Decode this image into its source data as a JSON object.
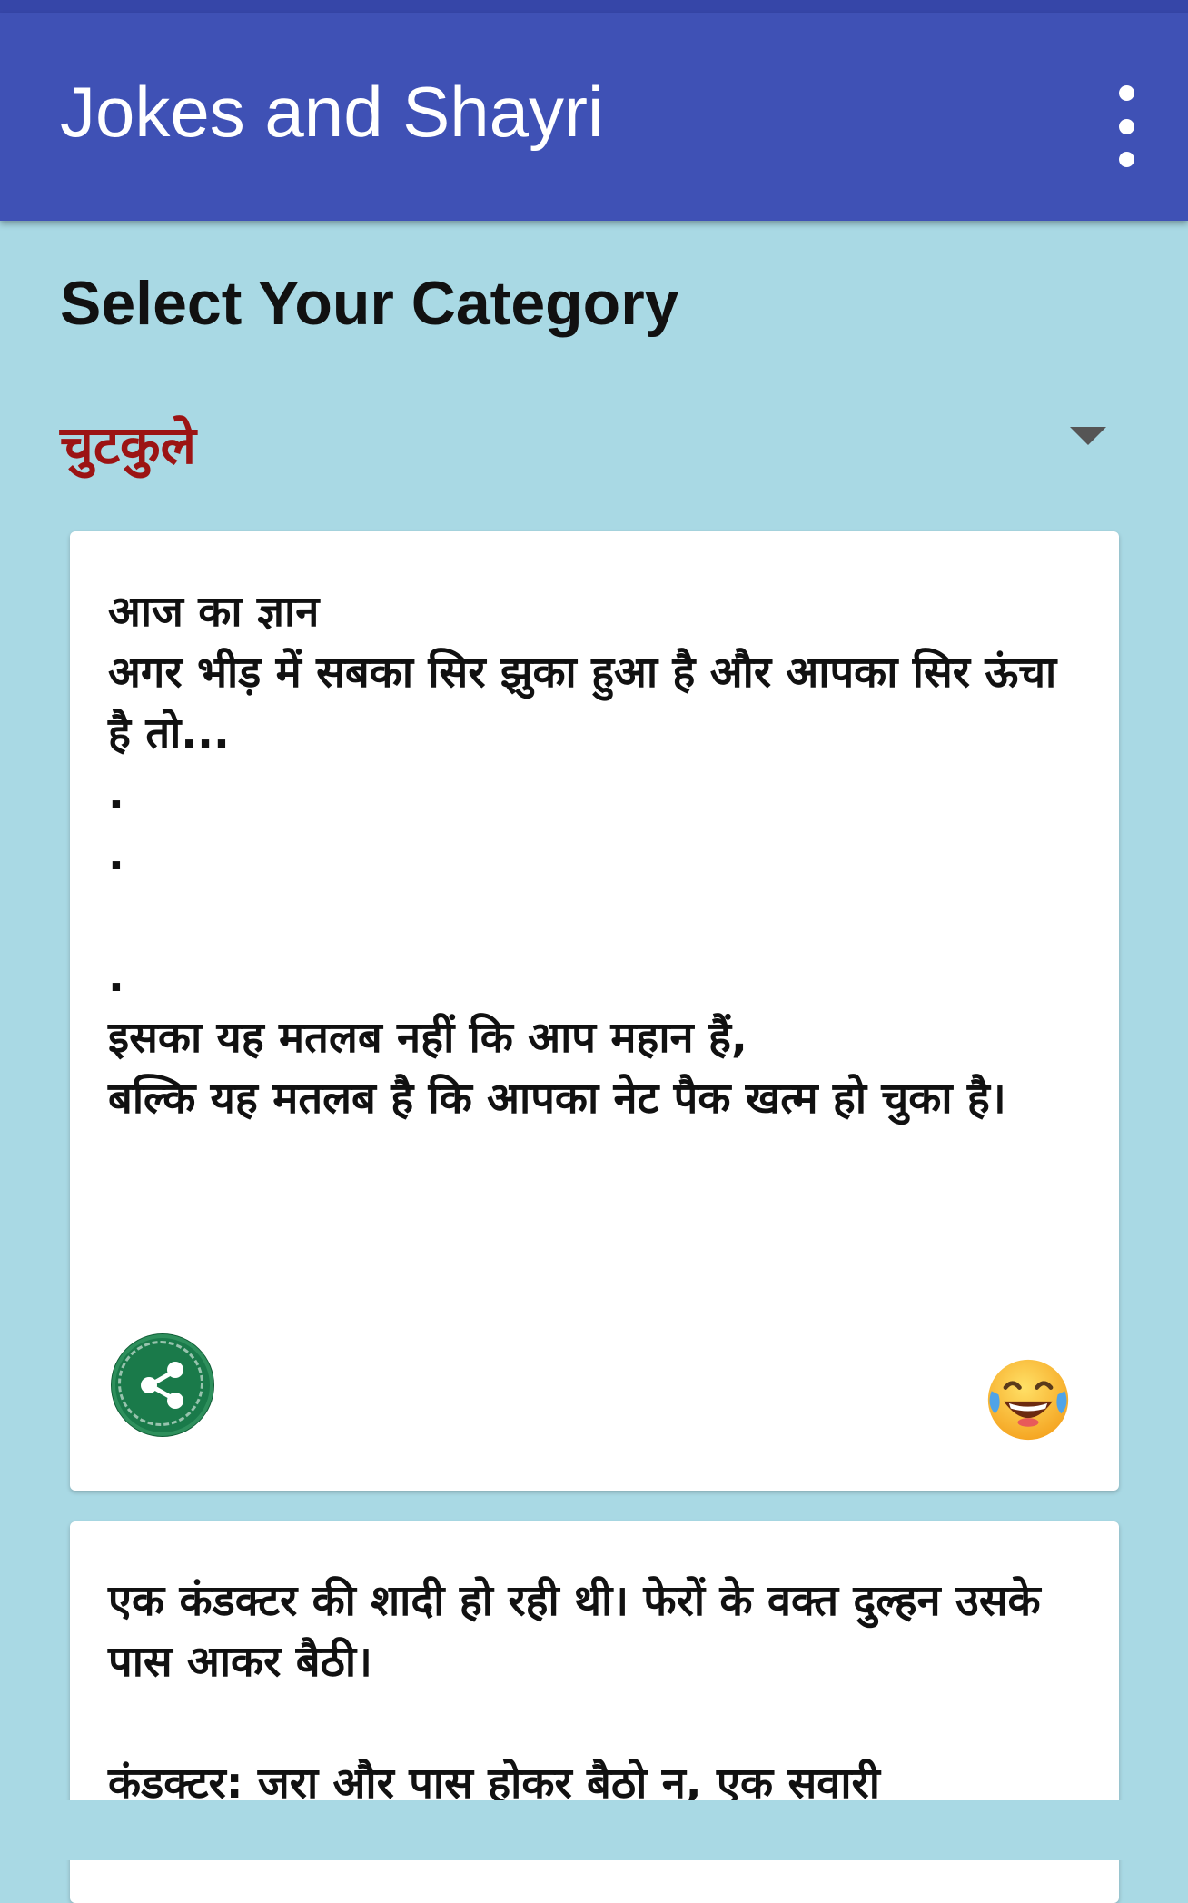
{
  "app_bar": {
    "title": "Jokes and Shayri",
    "menu_icon": "overflow-menu-icon"
  },
  "main": {
    "heading": "Select Your Category",
    "category_spinner": {
      "selected": "चुटकुले",
      "arrow_icon": "dropdown-arrow-icon"
    },
    "jokes": [
      {
        "text": "आज का ज्ञान\nअगर भीड़ में सबका सिर झुका हुआ है और आपका सिर ऊंचा है तो...\n.\n.\n\n.\nइसका यह मतलब नहीं कि आप महान हैं,\nबल्कि यह मतलब है कि आपका नेट पैक खत्म हो चुका है।",
        "share_icon": "share-icon",
        "reaction_icon": "laughing-emoji-icon"
      },
      {
        "text": "एक कंडक्टर की शादी हो रही थी। फेरों के वक्त दुल्हन उसके पास आकर बैठी।\n\nकंडक्टर: जरा और पास होकर बैठो न, एक सवारी"
      }
    ]
  },
  "colors": {
    "app_bar": "#3f51b5",
    "background": "#a9d9e4",
    "category_text": "#9c1414",
    "share_button": "#1a7a4a"
  }
}
